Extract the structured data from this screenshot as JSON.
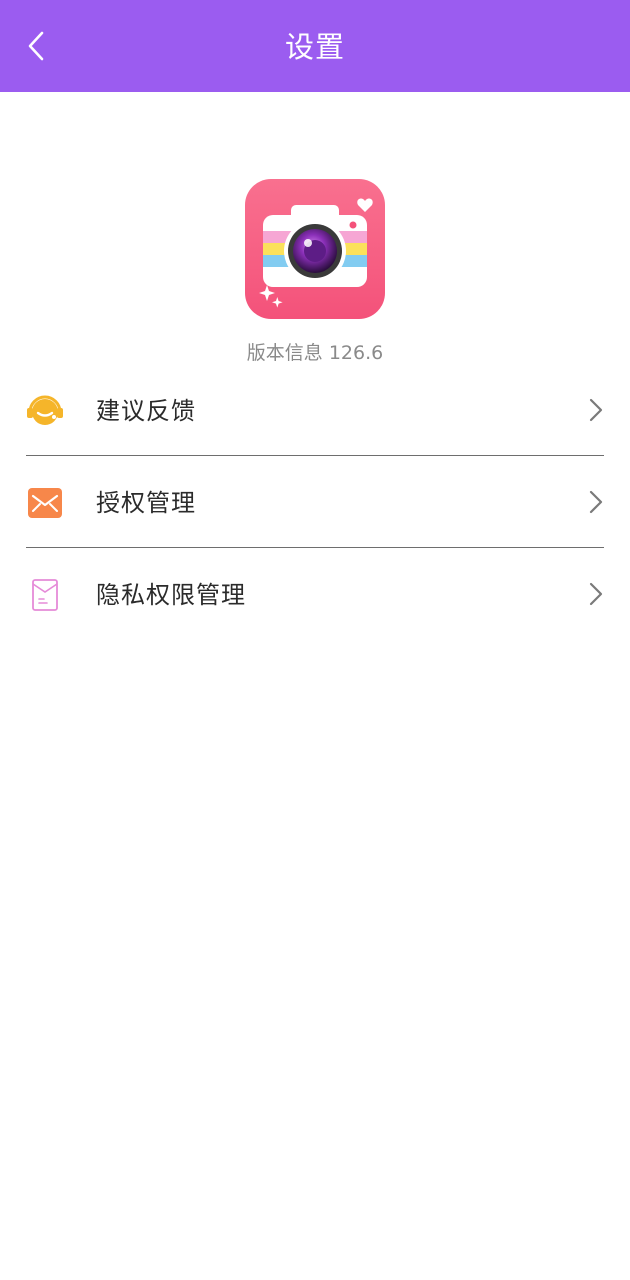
{
  "header": {
    "title": "设置",
    "background": "#9b5cf0"
  },
  "app": {
    "icon": "camera-app-logo",
    "version_text": "版本信息 126.6"
  },
  "menu": {
    "items": [
      {
        "label": "建议反馈",
        "icon": "headset-icon",
        "icon_color": "#f5b52a"
      },
      {
        "label": "授权管理",
        "icon": "envelope-icon",
        "icon_color": "#f7874a"
      },
      {
        "label": "隐私权限管理",
        "icon": "document-icon",
        "icon_color": "#e58bd8"
      }
    ]
  }
}
